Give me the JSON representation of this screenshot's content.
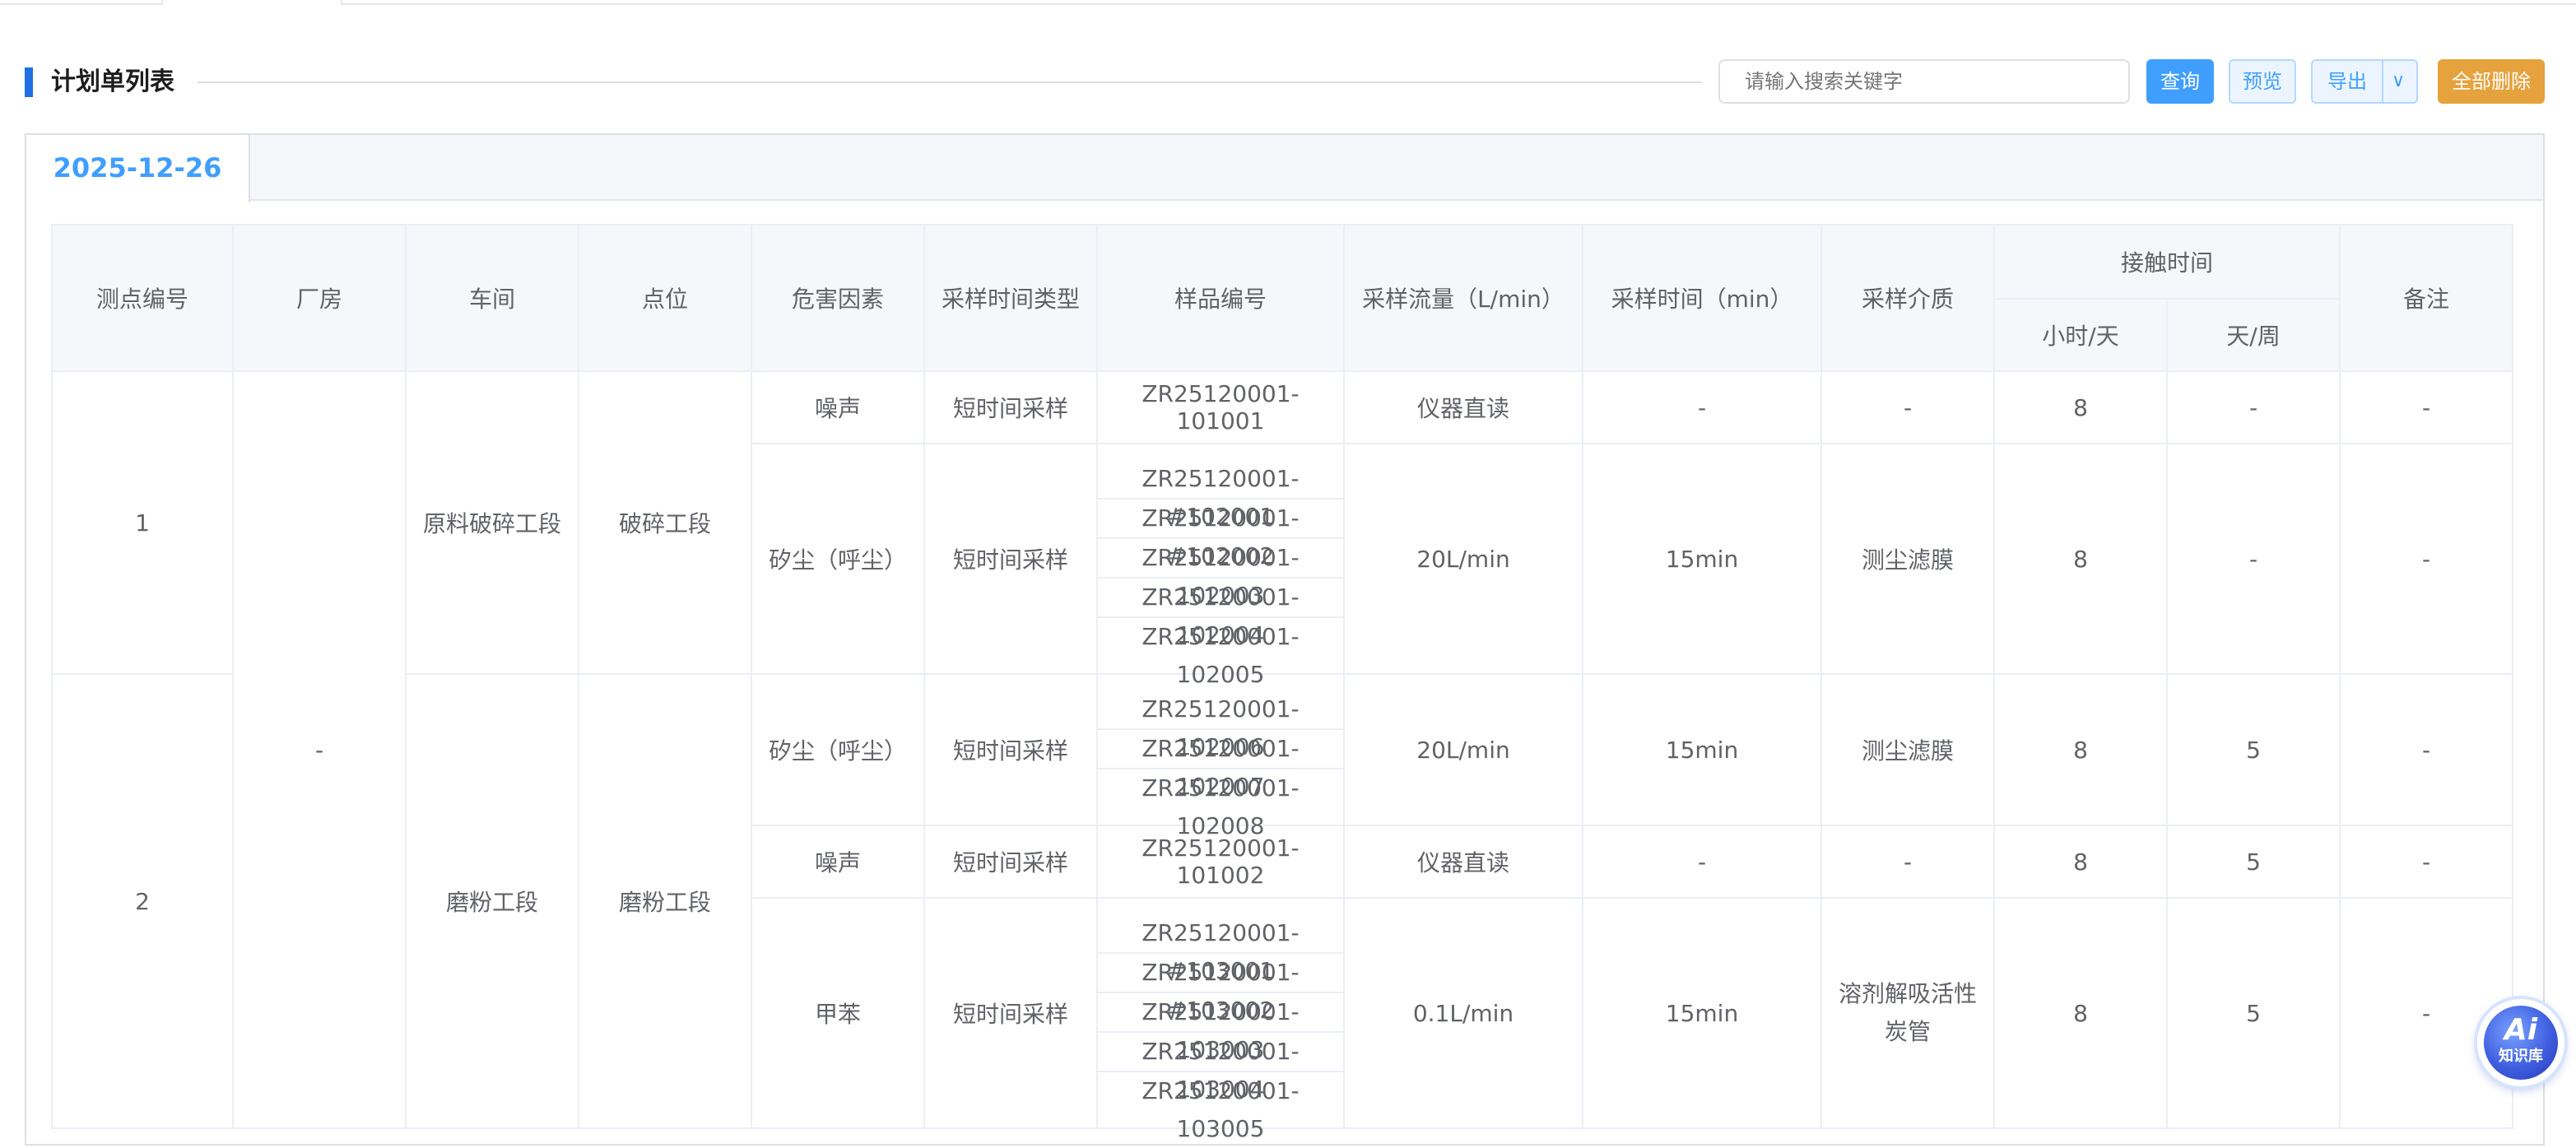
{
  "header": {
    "title": "计划单列表",
    "search_placeholder": "请输入搜索关键字",
    "query_label": "查询",
    "preview_label": "预览",
    "export_label": "导出",
    "delete_all_label": "全部删除"
  },
  "tab": {
    "date": "2025-12-26"
  },
  "table": {
    "headers": {
      "point_no": "测点编号",
      "plant": "厂房",
      "workshop": "车间",
      "position": "点位",
      "hazard": "危害因素",
      "time_type": "采样时间类型",
      "sample_no": "样品编号",
      "flow": "采样流量（L/min）",
      "sampling_time": "采样时间（min）",
      "medium": "采样介质",
      "contact_time": "接触时间",
      "hours_per_day": "小时/天",
      "days_per_week": "天/周",
      "remark": "备注"
    },
    "plant_value": "-",
    "groups": [
      {
        "point_no": "1",
        "workshop": "原料破碎工段",
        "position": "破碎工段",
        "rows": [
          {
            "hazard": "噪声",
            "time_type": "短时间采样",
            "samples": [
              "ZR25120001-101001"
            ],
            "flow": "仪器直读",
            "sampling_time": "-",
            "medium": "-",
            "hours_per_day": "8",
            "days_per_week": "-",
            "remark": "-"
          },
          {
            "hazard": "矽尘（呼尘）",
            "time_type": "短时间采样",
            "samples": [
              "ZR25120001-#102001",
              "ZR25120001-#102002",
              "ZR25120001-102003",
              "ZR25120001-102004",
              "ZR25120001-102005"
            ],
            "flow": "20L/min",
            "sampling_time": "15min",
            "medium": "测尘滤膜",
            "hours_per_day": "8",
            "days_per_week": "-",
            "remark": "-"
          }
        ]
      },
      {
        "point_no": "2",
        "workshop": "磨粉工段",
        "position": "磨粉工段",
        "rows": [
          {
            "hazard": "矽尘（呼尘）",
            "time_type": "短时间采样",
            "samples": [
              "ZR25120001-102006",
              "ZR25120001-102007",
              "ZR25120001-102008"
            ],
            "flow": "20L/min",
            "sampling_time": "15min",
            "medium": "测尘滤膜",
            "hours_per_day": "8",
            "days_per_week": "5",
            "remark": "-"
          },
          {
            "hazard": "噪声",
            "time_type": "短时间采样",
            "samples": [
              "ZR25120001-101002"
            ],
            "flow": "仪器直读",
            "sampling_time": "-",
            "medium": "-",
            "hours_per_day": "8",
            "days_per_week": "5",
            "remark": "-"
          },
          {
            "hazard": "甲苯",
            "time_type": "短时间采样",
            "samples": [
              "ZR25120001-#103001",
              "ZR25120001-#103002",
              "ZR25120001-103003",
              "ZR25120001-103004",
              "ZR25120001-103005"
            ],
            "flow": "0.1L/min",
            "sampling_time": "15min",
            "medium": "溶剂解吸活性炭管",
            "hours_per_day": "8",
            "days_per_week": "5",
            "remark": "-"
          }
        ]
      }
    ]
  },
  "ai_badge": {
    "big": "Ai",
    "small": "知识库"
  }
}
